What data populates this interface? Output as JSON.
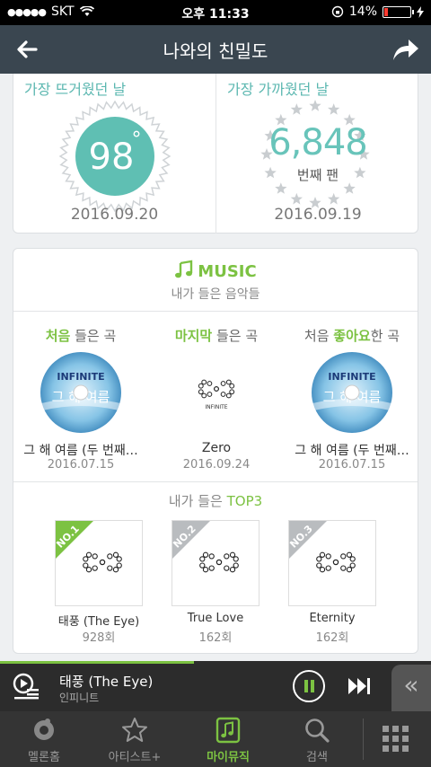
{
  "status": {
    "carrier": "SKT",
    "time": "오후 11:33",
    "battery": "14%",
    "battery_level": 0.14
  },
  "header": {
    "title": "나와의 친밀도"
  },
  "stats": {
    "hottest": {
      "label": "가장 뜨거웠던 날",
      "value": "98",
      "unit": "°",
      "date": "2016.09.20"
    },
    "closest": {
      "label": "가장 가까웠던 날",
      "value": "6,848",
      "sub": "번째 팬",
      "date": "2016.09.19"
    }
  },
  "music": {
    "title": "MUSIC",
    "subtitle": "내가 들은 음악들",
    "first": {
      "cap_bold": "처음",
      "cap_rest": " 들은 곡",
      "name": "그 해 여름 (두 번째…",
      "date": "2016.07.15"
    },
    "last": {
      "cap_bold": "마지막",
      "cap_rest": " 들은 곡",
      "name": "Zero",
      "date": "2016.09.24"
    },
    "liked": {
      "cap_pre": "처음 ",
      "cap_bold": "좋아요",
      "cap_rest": "한 곡",
      "name": "그 해 여름 (두 번째…",
      "date": "2016.07.15"
    },
    "top3_pre": "내가 들은 ",
    "top3_bold": "TOP3",
    "top3": [
      {
        "rank": "NO.1",
        "name": "태풍 (The Eye)",
        "count": "928회"
      },
      {
        "rank": "NO.2",
        "name": "True Love",
        "count": "162회"
      },
      {
        "rank": "NO.3",
        "name": "Eternity",
        "count": "162회"
      }
    ],
    "disc_text": {
      "brand": "INFINITE",
      "title": "그 해 여름"
    },
    "cover_text": "INFINITE"
  },
  "player": {
    "song": "태풍 (The Eye)",
    "artist": "인피니트",
    "progress": 0.45,
    "drawer": "«"
  },
  "tabs": [
    {
      "label": "멜론홈",
      "icon": "melon-icon"
    },
    {
      "label": "아티스트+",
      "icon": "star-icon"
    },
    {
      "label": "마이뮤직",
      "icon": "my-music-icon"
    },
    {
      "label": "검색",
      "icon": "search-icon"
    }
  ],
  "colors": {
    "accent": "#7cc242",
    "teal": "#5bb7b0",
    "header": "#3a4650"
  }
}
